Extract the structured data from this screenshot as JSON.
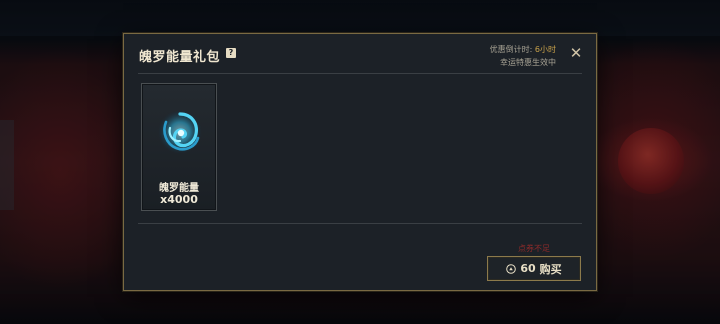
{
  "modal": {
    "title": "魄罗能量礼包",
    "help_glyph": "?",
    "timer_prefix": "优惠倒计时: ",
    "timer_value": "6小时",
    "timer_subtitle": "幸运特惠生效中",
    "close_glyph": "✕"
  },
  "item": {
    "name": "魄罗能量",
    "quantity": "x4000",
    "icon": "poro-energy-swirl-icon"
  },
  "purchase": {
    "warning": "点券不足",
    "price": "60",
    "label": "购买",
    "currency_icon": "coin-icon"
  },
  "colors": {
    "accent_gold": "#c9a24a",
    "warning_red": "#8e2a2a",
    "frame_gold": "#7a6a43"
  }
}
